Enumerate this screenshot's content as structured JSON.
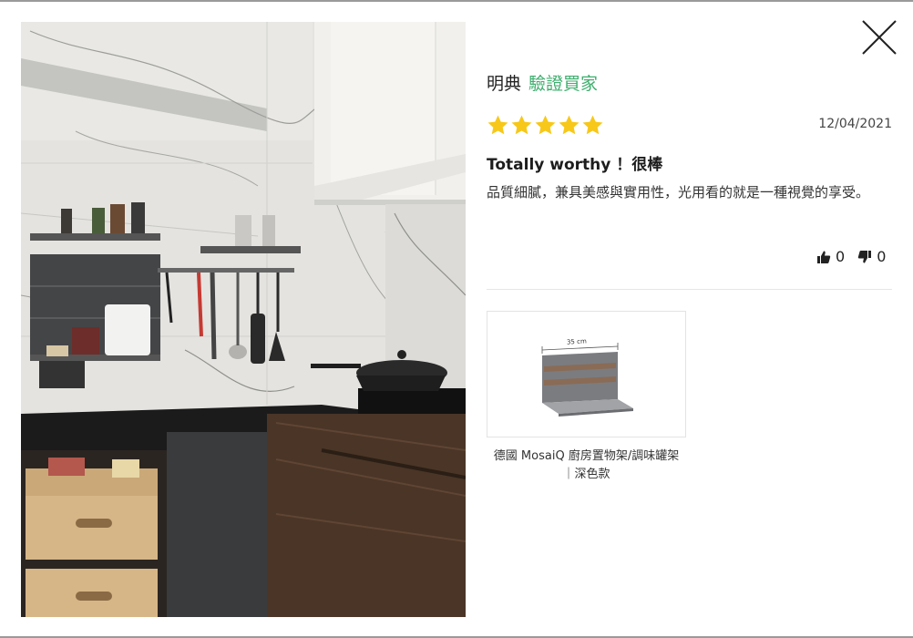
{
  "reviewer": {
    "name": "明典",
    "badge": "驗證買家"
  },
  "review": {
    "rating": 5,
    "rating_max": 5,
    "date": "12/04/2021",
    "title": "Totally worthy ！很棒",
    "body": "品質細膩，兼具美感與實用性，光用看的就是一種視覺的享受。"
  },
  "votes": {
    "helpful": "0",
    "unhelpful": "0"
  },
  "product": {
    "dimension_label": "35 cm",
    "name": "德國 MosaiQ 廚房置物架/調味罐架 ｜深色款"
  },
  "icons": {
    "close": "close-icon",
    "star": "star-icon",
    "thumbs_up": "thumbs-up-icon",
    "thumbs_down": "thumbs-down-icon"
  },
  "colors": {
    "verified": "#3fae6e",
    "star": "#f7c819"
  }
}
